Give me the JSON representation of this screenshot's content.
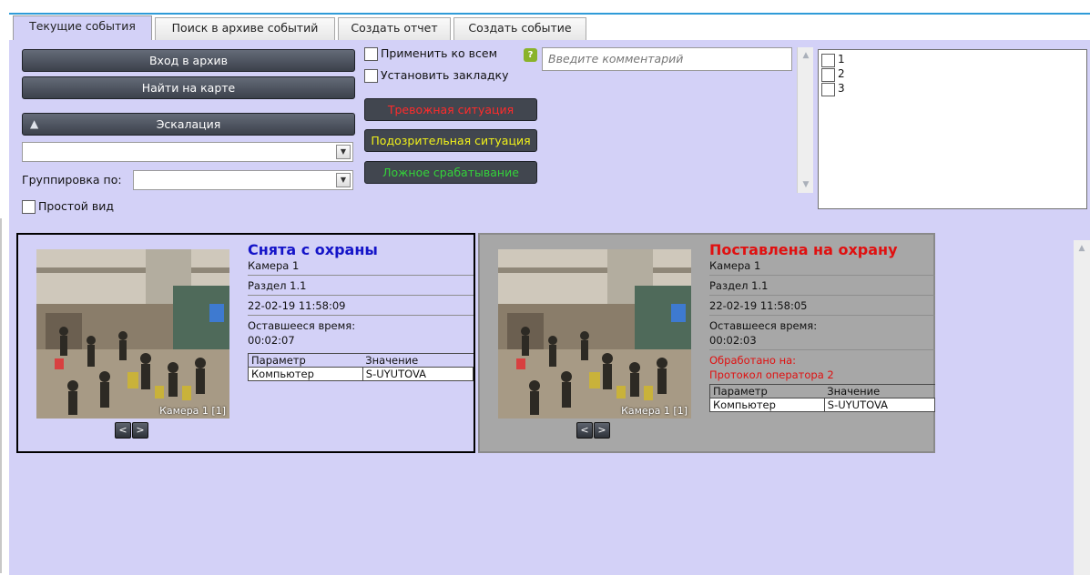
{
  "tabs": [
    "Текущие события",
    "Поиск в архиве событий",
    "Создать отчет",
    "Создать событие"
  ],
  "controls": {
    "archive_button": "Вход в архив",
    "map_button": "Найти на карте",
    "escalation_button": "Эскалация",
    "escalation_icon": "double-chevron-up-icon",
    "grouping_label": "Группировка по:",
    "simple_view_label": "Простой вид",
    "apply_all_label": "Применить ко всем",
    "bookmark_label": "Установить закладку",
    "help_glyph": "?",
    "comment_placeholder": "Введите комментарий",
    "reason_buttons": [
      {
        "label": "Тревожная ситуация",
        "color": "#ff2b2b"
      },
      {
        "label": "Подозрительная ситуация",
        "color": "#f2f21a"
      },
      {
        "label": "Ложное срабатывание",
        "color": "#34d23a"
      }
    ],
    "list_items": [
      "1",
      "2",
      "3"
    ]
  },
  "nav": {
    "prev": "<",
    "next": ">"
  },
  "events": [
    {
      "title": "Снята с охраны",
      "title_color": "#1414c8",
      "camera": "Камера 1",
      "section": "Раздел 1.1",
      "datetime": "22-02-19 11:58:09",
      "remaining_label": "Оставшееся время:",
      "remaining": "00:02:07",
      "processed_label": "",
      "processed_value": "",
      "caption": "Камера 1 [1]",
      "table_header": [
        "Параметр",
        "Значение"
      ],
      "table_row": [
        "Компьютер",
        "S-UYUTOVA"
      ]
    },
    {
      "title": "Поставлена на охрану",
      "title_color": "#e01010",
      "camera": "Камера 1",
      "section": "Раздел 1.1",
      "datetime": "22-02-19 11:58:05",
      "remaining_label": "Оставшееся время:",
      "remaining": "00:02:03",
      "processed_label": "Обработано на:",
      "processed_value": "Протокол оператора 2",
      "caption": "Камера 1 [1]",
      "table_header": [
        "Параметр",
        "Значение"
      ],
      "table_row": [
        "Компьютер",
        "S-UYUTOVA"
      ]
    }
  ]
}
